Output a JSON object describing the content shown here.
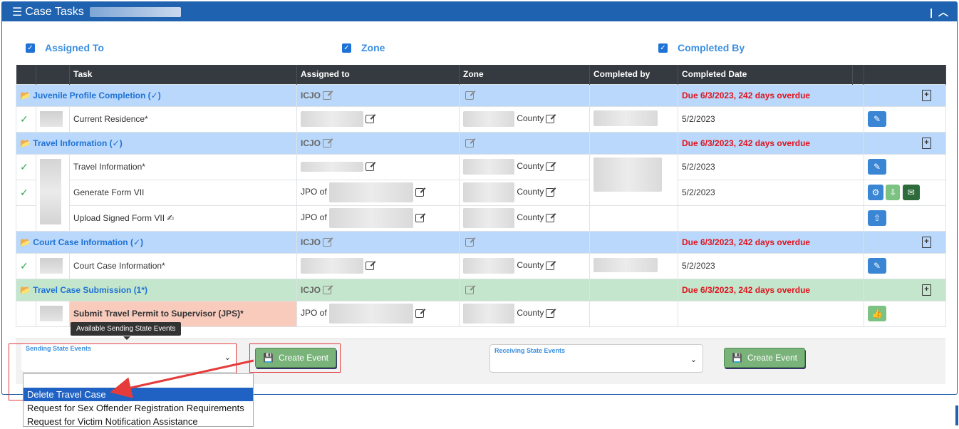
{
  "header": {
    "title": "Case Tasks"
  },
  "filters": [
    {
      "label": "Assigned To"
    },
    {
      "label": "Zone"
    },
    {
      "label": "Completed By"
    }
  ],
  "table": {
    "columns": [
      "",
      "",
      "Task",
      "Assigned to",
      "Zone",
      "Completed by",
      "Completed Date",
      "",
      ""
    ],
    "groups": [
      {
        "label": "Juvenile Profile Completion (✓)",
        "assigned": "ICJO",
        "due": "Due 6/3/2023, 242 days overdue"
      },
      {
        "label": "Travel Information (✓)",
        "assigned": "ICJO",
        "due": "Due 6/3/2023, 242 days overdue"
      },
      {
        "label": "Court Case Information (✓)",
        "assigned": "ICJO",
        "due": "Due 6/3/2023, 242 days overdue"
      },
      {
        "label": "Travel Case Submission (1*)",
        "assigned": "ICJO",
        "due": "Due 6/3/2023, 242 days overdue"
      }
    ],
    "tasks": [
      {
        "task": "Current Residence*",
        "assigned": "",
        "zone": "County",
        "date": "5/2/2023"
      },
      {
        "task": "Travel Information*",
        "assigned": "",
        "zone": "County",
        "date": "5/2/2023"
      },
      {
        "task": "Generate Form VII",
        "assigned": "JPO of",
        "zone": "County",
        "date": "5/2/2023"
      },
      {
        "task": "Upload Signed Form VII",
        "assigned": "JPO of",
        "zone": "County",
        "date": ""
      },
      {
        "task": "Court Case Information*",
        "assigned": "",
        "zone": "County",
        "date": "5/2/2023"
      },
      {
        "task": "Submit Travel Permit to Supervisor (JPS)*",
        "assigned": "JPO of",
        "zone": "County",
        "date": ""
      }
    ]
  },
  "tooltip": "Available Sending State Events",
  "sending": {
    "label": "Sending State Events",
    "button": "Create Event"
  },
  "receiving": {
    "label": "Receiving State Events",
    "button": "Create Event"
  },
  "dropdown_options": [
    "",
    "Delete Travel Case",
    "Request for Sex Offender Registration Requirements",
    "Request for Victim Notification Assistance"
  ],
  "colors": {
    "header": "#1e62b0",
    "group_row": "#b9d8fb",
    "submission_row": "#c4e6cc",
    "due": "#e0141e",
    "button": "#79b37a"
  }
}
